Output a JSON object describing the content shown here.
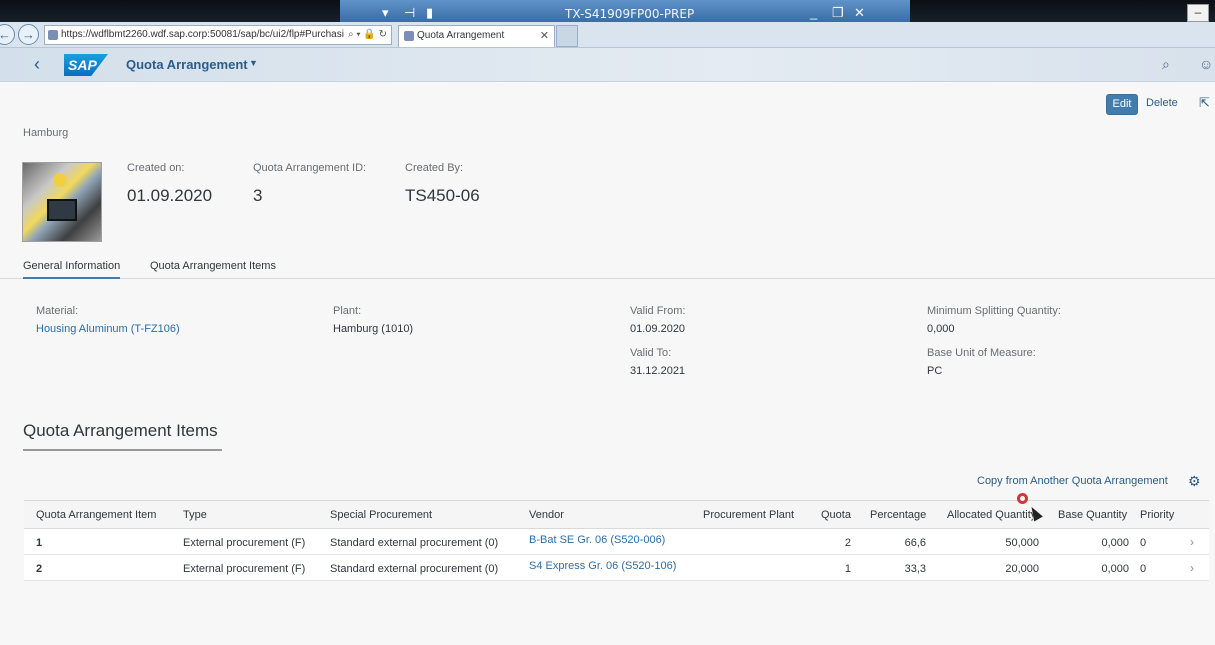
{
  "remote_session": {
    "title": "TX-S41909FP00-PREP"
  },
  "browser": {
    "url": "https://wdflbmt2260.wdf.sap.corp:50081/sap/bc/ui2/flp#Purchasi",
    "tab_title": "Quota Arrangement"
  },
  "shell": {
    "app_title": "Quota Arrangement"
  },
  "header": {
    "subtitle": "Hamburg",
    "actions": {
      "edit": "Edit",
      "delete": "Delete"
    },
    "created_on_label": "Created on:",
    "created_on_value": "01.09.2020",
    "qa_id_label": "Quota Arrangement ID:",
    "qa_id_value": "3",
    "created_by_label": "Created By:",
    "created_by_value": "TS450-06"
  },
  "tabs": [
    "General Information",
    "Quota Arrangement Items"
  ],
  "general": {
    "material_label": "Material:",
    "material_value": "Housing Aluminum (T-FZ106)",
    "plant_label": "Plant:",
    "plant_value": "Hamburg (1010)",
    "valid_from_label": "Valid From:",
    "valid_from_value": "01.09.2020",
    "valid_to_label": "Valid To:",
    "valid_to_value": "31.12.2021",
    "min_split_label": "Minimum Splitting Quantity:",
    "min_split_value": "0,000",
    "base_uom_label": "Base Unit of Measure:",
    "base_uom_value": "PC"
  },
  "items_section": {
    "title": "Quota Arrangement Items",
    "copy_action": "Copy from Another Quota Arrangement",
    "columns": [
      "Quota Arrangement Item",
      "Type",
      "Special Procurement",
      "Vendor",
      "Procurement Plant",
      "Quota",
      "Percentage",
      "Allocated Quantity",
      "Base Quantity",
      "Priority"
    ],
    "rows": [
      {
        "item": "1",
        "type": "External procurement (F)",
        "special": "Standard external procurement (0)",
        "vendor": "B-Bat SE Gr. 06 (S520-006)",
        "plant": "",
        "quota": "2",
        "percentage": "66,6",
        "allocated": "50,000",
        "base": "0,000",
        "priority": "0"
      },
      {
        "item": "2",
        "type": "External procurement (F)",
        "special": "Standard external procurement (0)",
        "vendor": "S4 Express Gr. 06 (S520-106)",
        "plant": "",
        "quota": "1",
        "percentage": "33,3",
        "allocated": "20,000",
        "base": "0,000",
        "priority": "0"
      }
    ]
  }
}
